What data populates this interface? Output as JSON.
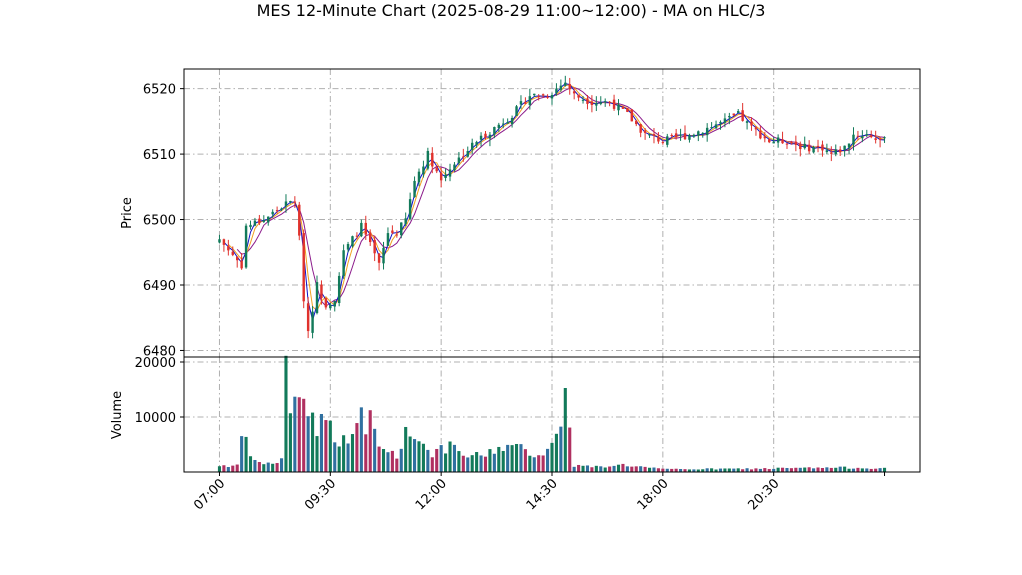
{
  "chart_data": {
    "type": "candlestick",
    "title": "MES 12-Minute Chart (2025-08-29 11:00~12:00) - MA on HLC/3",
    "price_panel": {
      "ylabel": "Price",
      "yticks": [
        6480,
        6490,
        6500,
        6510,
        6520
      ],
      "ylim": [
        6479,
        6523
      ]
    },
    "volume_panel": {
      "ylabel": "Volume",
      "yticks": [
        10000,
        20000
      ],
      "ylim": [
        0,
        20000
      ]
    },
    "xtick_labels": [
      "07:00",
      "09:30",
      "12:00",
      "14:30",
      "18:00",
      "20:30"
    ],
    "xtick_index": [
      0,
      25,
      50,
      75,
      100,
      125
    ],
    "xlim": [
      -8,
      158
    ],
    "grid": true,
    "colors": {
      "up": "#127a5a",
      "down": "#e0322d",
      "ma_fast": "#1010c8",
      "ma_mid": "#f0a020",
      "ma_slow": "#8b1a8b",
      "vol_up": "#127a5a",
      "vol_down": "#b03060",
      "vol_alt": "#3070a0"
    },
    "close_keypoints": [
      [
        0,
        6497
      ],
      [
        5,
        6493
      ],
      [
        6,
        6499
      ],
      [
        10,
        6500
      ],
      [
        14,
        6502
      ],
      [
        17,
        6503
      ],
      [
        18,
        6497
      ],
      [
        19,
        6488
      ],
      [
        20,
        6483
      ],
      [
        22,
        6490
      ],
      [
        24,
        6487
      ],
      [
        26,
        6488
      ],
      [
        28,
        6495
      ],
      [
        32,
        6499
      ],
      [
        34,
        6496
      ],
      [
        36,
        6493
      ],
      [
        38,
        6498
      ],
      [
        40,
        6498
      ],
      [
        42,
        6500
      ],
      [
        44,
        6506
      ],
      [
        47,
        6510
      ],
      [
        50,
        6506
      ],
      [
        52,
        6508
      ],
      [
        55,
        6510
      ],
      [
        58,
        6512
      ],
      [
        62,
        6514
      ],
      [
        66,
        6516
      ],
      [
        70,
        6519
      ],
      [
        74,
        6519
      ],
      [
        78,
        6521
      ],
      [
        80,
        6519
      ],
      [
        84,
        6518
      ],
      [
        88,
        6518
      ],
      [
        92,
        6516
      ],
      [
        96,
        6513
      ],
      [
        100,
        6512
      ],
      [
        106,
        6513
      ],
      [
        110,
        6514
      ],
      [
        114,
        6515
      ],
      [
        117,
        6516
      ],
      [
        120,
        6514
      ],
      [
        124,
        6512
      ],
      [
        128,
        6512
      ],
      [
        132,
        6511
      ],
      [
        136,
        6511
      ],
      [
        138,
        6510
      ],
      [
        141,
        6511
      ],
      [
        143,
        6513
      ],
      [
        146,
        6513
      ],
      [
        150,
        6512
      ]
    ],
    "volume_keypoints": [
      [
        0,
        1200
      ],
      [
        4,
        1100
      ],
      [
        5,
        6800
      ],
      [
        8,
        1800
      ],
      [
        12,
        1500
      ],
      [
        14,
        2200
      ],
      [
        15,
        18800
      ],
      [
        16,
        11500
      ],
      [
        17,
        15500
      ],
      [
        18,
        14000
      ],
      [
        20,
        11500
      ],
      [
        22,
        8500
      ],
      [
        24,
        9500
      ],
      [
        26,
        6800
      ],
      [
        28,
        5500
      ],
      [
        32,
        9800
      ],
      [
        33,
        7000
      ],
      [
        34,
        10200
      ],
      [
        36,
        4500
      ],
      [
        40,
        3200
      ],
      [
        42,
        6800
      ],
      [
        44,
        7200
      ],
      [
        46,
        5000
      ],
      [
        48,
        3500
      ],
      [
        52,
        4500
      ],
      [
        56,
        2800
      ],
      [
        60,
        3200
      ],
      [
        64,
        4800
      ],
      [
        68,
        4200
      ],
      [
        72,
        3000
      ],
      [
        76,
        6200
      ],
      [
        77,
        7800
      ],
      [
        78,
        15300
      ],
      [
        79,
        9500
      ],
      [
        80,
        1200
      ],
      [
        86,
        900
      ],
      [
        90,
        1400
      ],
      [
        100,
        500
      ],
      [
        120,
        600
      ],
      [
        140,
        800
      ],
      [
        150,
        700
      ]
    ]
  }
}
